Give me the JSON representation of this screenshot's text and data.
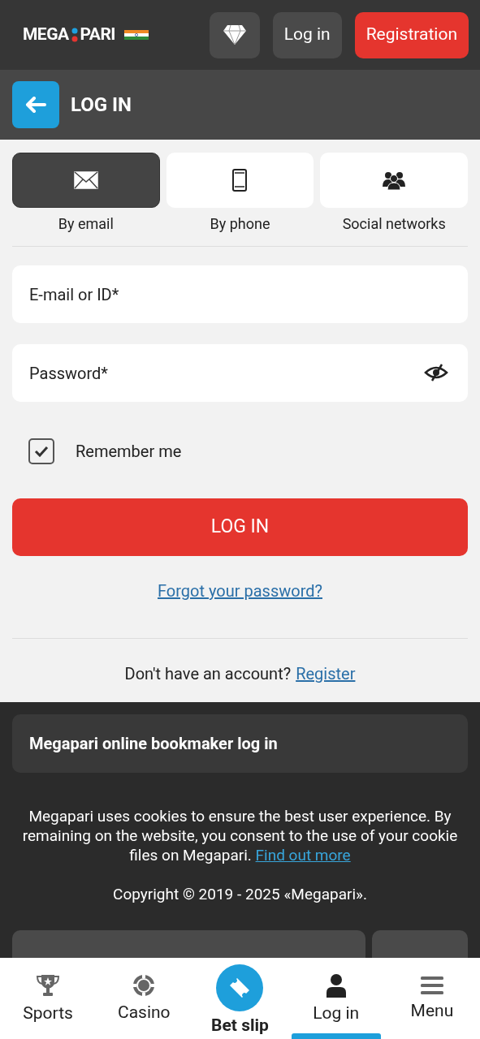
{
  "header": {
    "logo": {
      "left": "MEGA",
      "right": "PARI"
    },
    "login_button": "Log in",
    "registration_button": "Registration"
  },
  "title_bar": {
    "title": "LOG IN"
  },
  "methods": [
    {
      "kind": "email",
      "label": "By email",
      "selected": true
    },
    {
      "kind": "phone",
      "label": "By phone",
      "selected": false
    },
    {
      "kind": "social",
      "label": "Social networks",
      "selected": false
    }
  ],
  "fields": [
    {
      "placeholder": "E-mail or ID*",
      "kind": "text"
    },
    {
      "placeholder": "Password*",
      "kind": "password"
    }
  ],
  "remember": {
    "label": "Remember me",
    "checked": true
  },
  "submit": "LOG IN",
  "forgot_link": "Forgot your password?",
  "signup": {
    "text": "Don't have an account?",
    "link": "Register"
  },
  "footer": {
    "info_title": "Megapari online bookmaker log in",
    "cookie_text": "Megapari uses cookies to ensure the best user experience. By remaining on the website, you consent to the use of your cookie files on Megapari.",
    "cookie_link": "Find out more",
    "copyright": "Copyright © 2019 - 2025 «Megapari»."
  },
  "bottom_nav": [
    {
      "kind": "sports",
      "label": "Sports",
      "selected": false
    },
    {
      "kind": "casino",
      "label": "Casino",
      "selected": false
    },
    {
      "kind": "betslip",
      "label": "Bet slip",
      "selected": false
    },
    {
      "kind": "login",
      "label": "Log in",
      "selected": true
    },
    {
      "kind": "menu",
      "label": "Menu",
      "selected": false
    }
  ]
}
